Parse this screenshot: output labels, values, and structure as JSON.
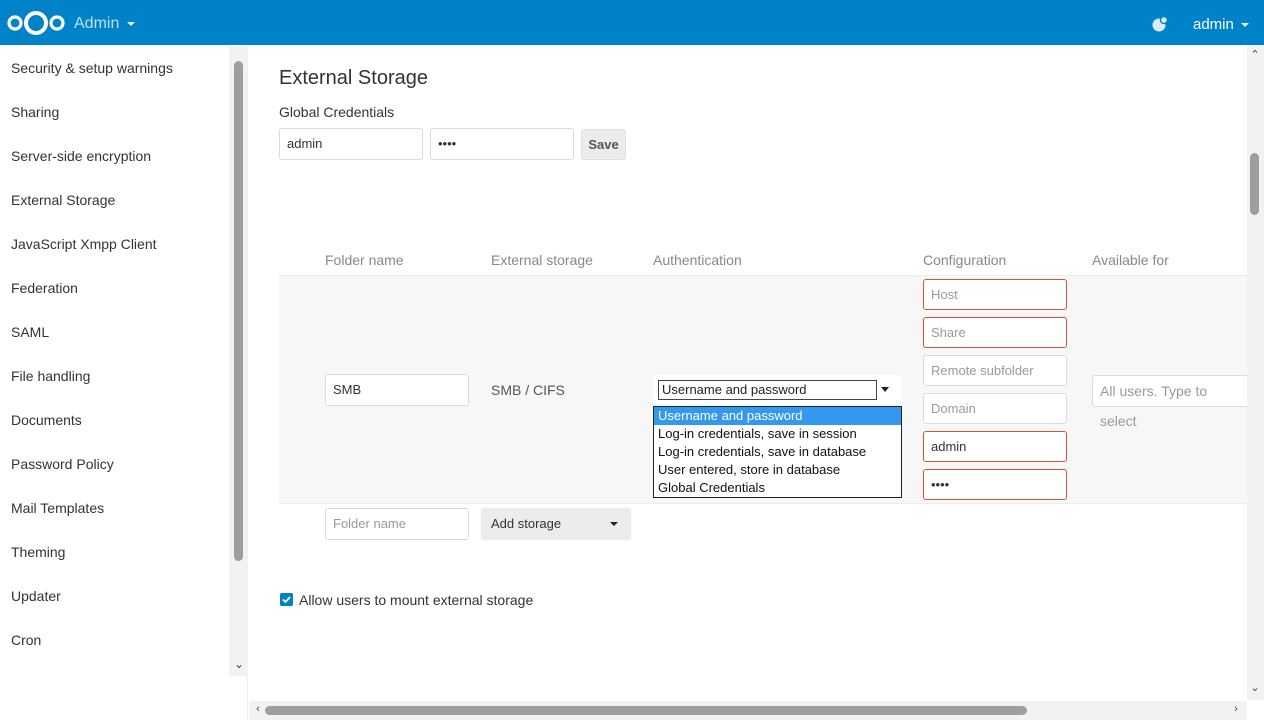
{
  "header": {
    "app_name": "Admin",
    "user_name": "admin",
    "colors": {
      "primary": "#0082c9"
    },
    "icons": [
      "nextcloud-logo-icon",
      "notifications-icon",
      "chevron-down-icon"
    ]
  },
  "sidebar": {
    "items": [
      {
        "label": "Security & setup warnings"
      },
      {
        "label": "Sharing"
      },
      {
        "label": "Server-side encryption"
      },
      {
        "label": "External Storage"
      },
      {
        "label": "JavaScript Xmpp Client"
      },
      {
        "label": "Federation"
      },
      {
        "label": "SAML"
      },
      {
        "label": "File handling"
      },
      {
        "label": "Documents"
      },
      {
        "label": "Password Policy"
      },
      {
        "label": "Mail Templates"
      },
      {
        "label": "Theming"
      },
      {
        "label": "Updater"
      },
      {
        "label": "Cron"
      }
    ]
  },
  "main": {
    "title": "External Storage",
    "global_credentials": {
      "label": "Global Credentials",
      "username": "admin",
      "password_mask": "••••",
      "save_label": "Save"
    },
    "table": {
      "headers": {
        "folder_name": "Folder name",
        "external_storage": "External storage",
        "authentication": "Authentication",
        "configuration": "Configuration",
        "available_for": "Available for"
      },
      "row": {
        "folder_name": "SMB",
        "storage_type": "SMB / CIFS",
        "auth_selected": "Username and password",
        "auth_options": [
          {
            "label": "Username and password",
            "selected": true
          },
          {
            "label": "Log-in credentials, save in session",
            "selected": false
          },
          {
            "label": "Log-in credentials, save in database",
            "selected": false
          },
          {
            "label": "User entered, store in database",
            "selected": false
          },
          {
            "label": "Global Credentials",
            "selected": false
          }
        ],
        "config": {
          "host_placeholder": "Host",
          "share_placeholder": "Share",
          "remote_subfolder_placeholder": "Remote subfolder",
          "domain_placeholder": "Domain",
          "user_value": "admin",
          "password_mask": "••••"
        },
        "available_for_placeholder": "All users. Type to select"
      },
      "new_row": {
        "folder_name_placeholder": "Folder name",
        "add_storage_label": "Add storage"
      }
    },
    "allow_user_mounting": {
      "label": "Allow users to mount external storage",
      "checked": true
    }
  }
}
